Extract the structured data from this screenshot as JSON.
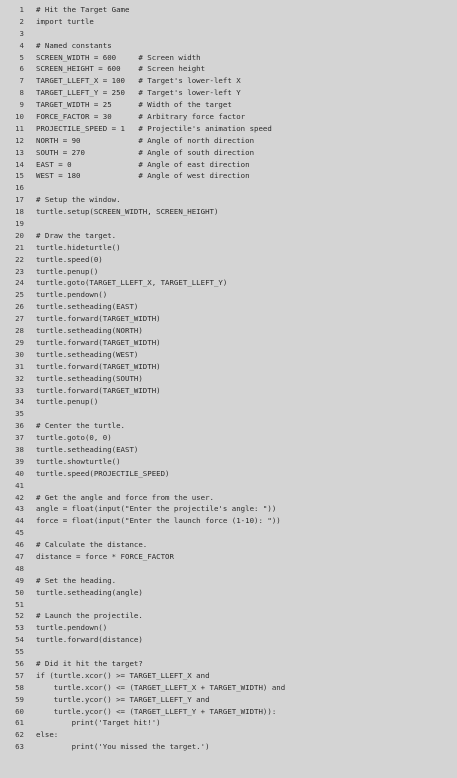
{
  "lines": [
    {
      "n": "1",
      "code": "# Hit the Target Game"
    },
    {
      "n": "2",
      "code": "import turtle"
    },
    {
      "n": "3",
      "code": ""
    },
    {
      "n": "4",
      "code": "# Named constants"
    },
    {
      "n": "5",
      "code": "SCREEN_WIDTH = 600     # Screen width"
    },
    {
      "n": "6",
      "code": "SCREEN_HEIGHT = 600    # Screen height"
    },
    {
      "n": "7",
      "code": "TARGET_LLEFT_X = 100   # Target's lower-left X"
    },
    {
      "n": "8",
      "code": "TARGET_LLEFT_Y = 250   # Target's lower-left Y"
    },
    {
      "n": "9",
      "code": "TARGET_WIDTH = 25      # Width of the target"
    },
    {
      "n": "10",
      "code": "FORCE_FACTOR = 30      # Arbitrary force factor"
    },
    {
      "n": "11",
      "code": "PROJECTILE_SPEED = 1   # Projectile's animation speed"
    },
    {
      "n": "12",
      "code": "NORTH = 90             # Angle of north direction"
    },
    {
      "n": "13",
      "code": "SOUTH = 270            # Angle of south direction"
    },
    {
      "n": "14",
      "code": "EAST = 0               # Angle of east direction"
    },
    {
      "n": "15",
      "code": "WEST = 180             # Angle of west direction"
    },
    {
      "n": "16",
      "code": ""
    },
    {
      "n": "17",
      "code": "# Setup the window."
    },
    {
      "n": "18",
      "code": "turtle.setup(SCREEN_WIDTH, SCREEN_HEIGHT)"
    },
    {
      "n": "19",
      "code": ""
    },
    {
      "n": "20",
      "code": "# Draw the target."
    },
    {
      "n": "21",
      "code": "turtle.hideturtle()"
    },
    {
      "n": "22",
      "code": "turtle.speed(0)"
    },
    {
      "n": "23",
      "code": "turtle.penup()"
    },
    {
      "n": "24",
      "code": "turtle.goto(TARGET_LLEFT_X, TARGET_LLEFT_Y)"
    },
    {
      "n": "25",
      "code": "turtle.pendown()"
    },
    {
      "n": "26",
      "code": "turtle.setheading(EAST)"
    },
    {
      "n": "27",
      "code": "turtle.forward(TARGET_WIDTH)"
    },
    {
      "n": "28",
      "code": "turtle.setheading(NORTH)"
    },
    {
      "n": "29",
      "code": "turtle.forward(TARGET_WIDTH)"
    },
    {
      "n": "30",
      "code": "turtle.setheading(WEST)"
    },
    {
      "n": "31",
      "code": "turtle.forward(TARGET_WIDTH)"
    },
    {
      "n": "32",
      "code": "turtle.setheading(SOUTH)"
    },
    {
      "n": "33",
      "code": "turtle.forward(TARGET_WIDTH)"
    },
    {
      "n": "34",
      "code": "turtle.penup()"
    },
    {
      "n": "35",
      "code": ""
    },
    {
      "n": "36",
      "code": "# Center the turtle."
    },
    {
      "n": "37",
      "code": "turtle.goto(0, 0)"
    },
    {
      "n": "38",
      "code": "turtle.setheading(EAST)"
    },
    {
      "n": "39",
      "code": "turtle.showturtle()"
    },
    {
      "n": "40",
      "code": "turtle.speed(PROJECTILE_SPEED)"
    },
    {
      "n": "41",
      "code": ""
    },
    {
      "n": "42",
      "code": "# Get the angle and force from the user."
    },
    {
      "n": "43",
      "code": "angle = float(input(\"Enter the projectile's angle: \"))"
    },
    {
      "n": "44",
      "code": "force = float(input(\"Enter the launch force (1-10): \"))"
    },
    {
      "n": "45",
      "code": ""
    },
    {
      "n": "46",
      "code": "# Calculate the distance."
    },
    {
      "n": "47",
      "code": "distance = force * FORCE_FACTOR"
    },
    {
      "n": "48",
      "code": ""
    },
    {
      "n": "49",
      "code": "# Set the heading."
    },
    {
      "n": "50",
      "code": "turtle.setheading(angle)"
    },
    {
      "n": "51",
      "code": ""
    },
    {
      "n": "52",
      "code": "# Launch the projectile."
    },
    {
      "n": "53",
      "code": "turtle.pendown()"
    },
    {
      "n": "54",
      "code": "turtle.forward(distance)"
    },
    {
      "n": "55",
      "code": ""
    },
    {
      "n": "56",
      "code": "# Did it hit the target?"
    },
    {
      "n": "57",
      "code": "if (turtle.xcor() >= TARGET_LLEFT_X and"
    },
    {
      "n": "58",
      "code": "    turtle.xcor() <= (TARGET_LLEFT_X + TARGET_WIDTH) and"
    },
    {
      "n": "59",
      "code": "    turtle.ycor() >= TARGET_LLEFT_Y and"
    },
    {
      "n": "60",
      "code": "    turtle.ycor() <= (TARGET_LLEFT_Y + TARGET_WIDTH)):"
    },
    {
      "n": "61",
      "code": "        print('Target hit!')"
    },
    {
      "n": "62",
      "code": "else:"
    },
    {
      "n": "63",
      "code": "        print('You missed the target.')"
    }
  ]
}
